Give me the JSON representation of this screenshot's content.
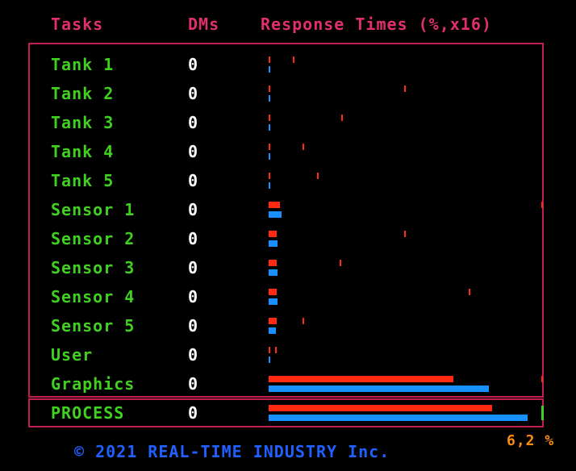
{
  "header": {
    "tasks_label": "Tasks",
    "dms_label": "DMs",
    "response_label": "Response Times (%,x16)"
  },
  "tasks": [
    {
      "name": "Tank 1",
      "dms": "0"
    },
    {
      "name": "Tank 2",
      "dms": "0"
    },
    {
      "name": "Tank 3",
      "dms": "0"
    },
    {
      "name": "Tank 4",
      "dms": "0"
    },
    {
      "name": "Tank 5",
      "dms": "0"
    },
    {
      "name": "Sensor 1",
      "dms": "0"
    },
    {
      "name": "Sensor 2",
      "dms": "0"
    },
    {
      "name": "Sensor 3",
      "dms": "0"
    },
    {
      "name": "Sensor 4",
      "dms": "0"
    },
    {
      "name": "Sensor 5",
      "dms": "0"
    },
    {
      "name": "User",
      "dms": "0"
    },
    {
      "name": "Graphics",
      "dms": "0"
    }
  ],
  "process": {
    "name": "PROCESS",
    "dms": "0"
  },
  "footer": {
    "copyright": "© 2021 REAL-TIME INDUSTRY Inc.",
    "cpu_percent": "6,2 %"
  },
  "colors": {
    "task_name": "#40d020",
    "header": "#e0306a",
    "frame": "#c02050",
    "bar_red": "#ff2a10",
    "bar_blue": "#1890ff",
    "footer": "#2060ff",
    "percent": "#ff8c10"
  }
}
